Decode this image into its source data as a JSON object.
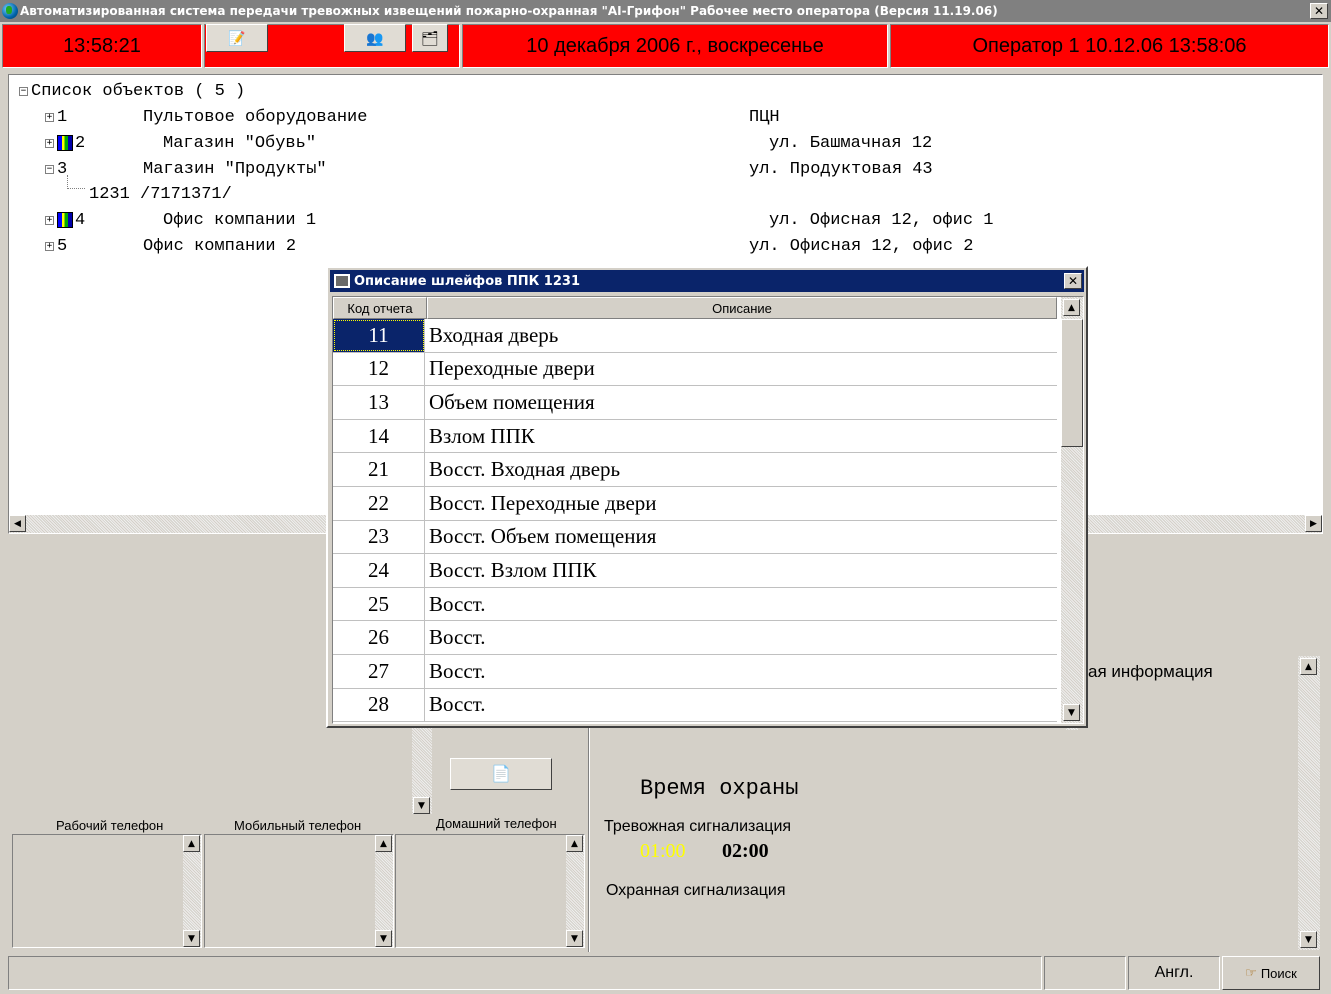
{
  "window": {
    "title": "Автоматизированная система передачи тревожных извещений пожарно-охранная \"AI-Грифон\" Рабочее место оператора (Версия 11.19.06)",
    "close_glyph": "✕"
  },
  "statusbar": {
    "time": "13:58:21",
    "date": "10 декабря 2006 г., воскресенье",
    "operator": "Оператор 1  10.12.06 13:58:06",
    "accent_color": "#ff0000"
  },
  "tree": {
    "root_label": "Список объектов ( 5 )",
    "items": [
      {
        "num": "1",
        "name": "Пультовое оборудование",
        "address": "ПЦН"
      },
      {
        "num": "2",
        "name": "Магазин \"Обувь\"",
        "address": "ул. Башмачная 12"
      },
      {
        "num": "3",
        "name": "Магазин \"Продукты\"",
        "address": "ул. Продуктовая 43"
      },
      {
        "num": "4",
        "name": "Офис компании 1",
        "address": "ул. Офисная 12, офис 1"
      },
      {
        "num": "5",
        "name": "Офис компании 2",
        "address": "ул. Офисная 12, офис 2"
      }
    ],
    "child_of_3": "1231 /7171371/",
    "expand_glyph": "+",
    "collapse_glyph": "−"
  },
  "dialog": {
    "title": "Описание шлейфов ППК 1231",
    "col_code": "Код отчета",
    "col_desc": "Описание",
    "rows": [
      {
        "code": "11",
        "desc": "Входная дверь"
      },
      {
        "code": "12",
        "desc": "Переходные двери"
      },
      {
        "code": "13",
        "desc": "Объем помещения"
      },
      {
        "code": "14",
        "desc": "Взлом ППК"
      },
      {
        "code": "21",
        "desc": "Восст. Входная дверь"
      },
      {
        "code": "22",
        "desc": "Восст. Переходные двери"
      },
      {
        "code": "23",
        "desc": "Восст. Объем помещения"
      },
      {
        "code": "24",
        "desc": "Восст. Взлом ППК"
      },
      {
        "code": "25",
        "desc": "Восст."
      },
      {
        "code": "26",
        "desc": "Восст."
      },
      {
        "code": "27",
        "desc": "Восст."
      },
      {
        "code": "28",
        "desc": "Восст."
      }
    ],
    "selected_row": 0
  },
  "lower": {
    "extra_info_partial": "ая информация",
    "guard_time_title": "Время  охраны",
    "alarm_signal_label": "Тревожная сигнализация",
    "alarm_time_1": "01:00",
    "alarm_time_2": "02:00",
    "alarm_time_1_color": "#ffff00",
    "security_signal_label": "Охранная  сигнализация",
    "work_phone_label": "Рабочий телефон",
    "mobile_phone_label": "Мобильный телефон",
    "home_phone_label": "Домашний телефон"
  },
  "bottombar": {
    "language": "Англ.",
    "search_label": "Поиск"
  },
  "icons": {
    "scroll_up": "▲",
    "scroll_down": "▼",
    "scroll_left": "◀",
    "scroll_right": "▶",
    "notepad": "📝",
    "people": "👥",
    "properties": "🗂",
    "document": "📄",
    "search_hand": "☞"
  }
}
